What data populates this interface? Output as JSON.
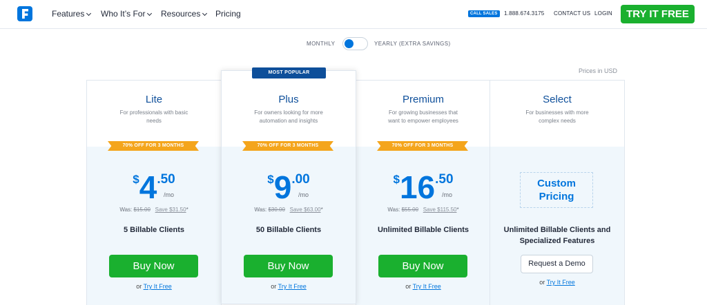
{
  "nav": {
    "links": [
      "Features",
      "Who It’s For",
      "Resources",
      "Pricing"
    ],
    "call_badge": "CALL SALES",
    "phone": "1.888.674.3175",
    "contact": "CONTACT US",
    "login": "LOGIN",
    "cta": "TRY IT FREE"
  },
  "billing": {
    "monthly": "MONTHLY",
    "yearly": "YEARLY (EXTRA SAVINGS)",
    "selected": "monthly"
  },
  "currency_note": "Prices in USD",
  "colors": {
    "brand_blue": "#0075dd",
    "navy": "#0e4f9a",
    "cta_green": "#1ab02f",
    "ribbon_orange": "#f4a51c"
  },
  "plans": [
    {
      "name": "Lite",
      "desc": "For professionals with basic needs",
      "ribbon": "70% OFF FOR 3 MONTHS",
      "currency": "$",
      "price_whole": "4",
      "price_cents": ".50",
      "per": "/mo",
      "was_label": "Was:",
      "was_price": "$15.00",
      "save": "Save $31.50",
      "save_mark": "*",
      "clients": "5 Billable Clients",
      "button": "Buy Now",
      "or": "or",
      "try_link": "Try It Free"
    },
    {
      "name": "Plus",
      "badge": "MOST POPULAR",
      "desc": "For owners looking for more automation and insights",
      "ribbon": "70% OFF FOR 3 MONTHS",
      "currency": "$",
      "price_whole": "9",
      "price_cents": ".00",
      "per": "/mo",
      "was_label": "Was:",
      "was_price": "$30.00",
      "save": "Save $63.00",
      "save_mark": "*",
      "clients": "50 Billable Clients",
      "button": "Buy Now",
      "or": "or",
      "try_link": "Try It Free"
    },
    {
      "name": "Premium",
      "desc": "For growing businesses that want to empower employees",
      "ribbon": "70% OFF FOR 3 MONTHS",
      "currency": "$",
      "price_whole": "16",
      "price_cents": ".50",
      "per": "/mo",
      "was_label": "Was:",
      "was_price": "$55.00",
      "save": "Save $115.50",
      "save_mark": "*",
      "clients": "Unlimited Billable Clients",
      "button": "Buy Now",
      "or": "or",
      "try_link": "Try It Free"
    },
    {
      "name": "Select",
      "desc": "For businesses with more complex needs",
      "custom_line1": "Custom",
      "custom_line2": "Pricing",
      "clients_line1": "Unlimited Billable Clients and",
      "clients_line2": "Specialized Features",
      "button": "Request a Demo",
      "or": "or",
      "try_link": "Try It Free"
    }
  ]
}
